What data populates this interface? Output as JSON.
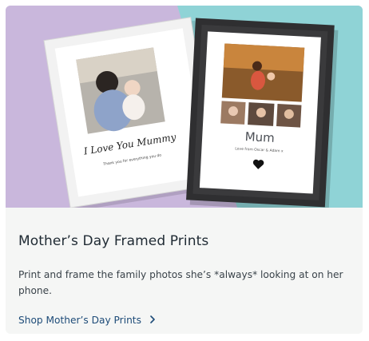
{
  "card": {
    "title": "Mother’s Day Framed Prints",
    "description": "Print and frame the family photos she’s *always* looking at on her phone.",
    "cta_label": "Shop Mother’s Day Prints",
    "cta_icon": "chevron-right-icon"
  },
  "hero": {
    "left_print": {
      "script_text": "I Love You Mummy",
      "caption": "Thank you for everything you do"
    },
    "right_print": {
      "name": "Mum",
      "caption": "Love from Oscar & Adam x",
      "icon": "heart-icon"
    }
  },
  "colors": {
    "bg_lavender": "#c9b7dc",
    "bg_teal": "#8fd3d6",
    "title": "#1f2a33",
    "text": "#3a434a",
    "link": "#1d4b78",
    "card_bg": "#f5f6f5"
  }
}
